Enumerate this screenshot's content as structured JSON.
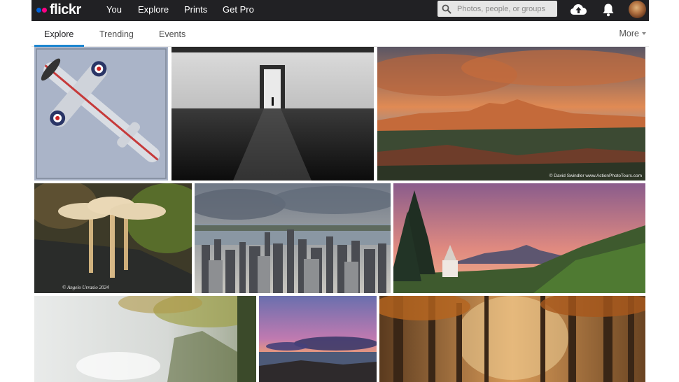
{
  "header": {
    "logo_text": "flickr",
    "nav": [
      {
        "label": "You"
      },
      {
        "label": "Explore"
      },
      {
        "label": "Prints"
      },
      {
        "label": "Get Pro"
      }
    ],
    "search": {
      "placeholder": "Photos, people, or groups",
      "value": ""
    },
    "icons": [
      "upload-cloud-icon",
      "notification-bell-icon",
      "user-avatar"
    ]
  },
  "subnav": {
    "tabs": [
      {
        "label": "Explore",
        "active": true
      },
      {
        "label": "Trending",
        "active": false
      },
      {
        "label": "Events",
        "active": false
      }
    ],
    "more_label": "More"
  },
  "photos": [
    {
      "subject": "spitfire aircraft",
      "credit": ""
    },
    {
      "subject": "black and white corridor",
      "credit": ""
    },
    {
      "subject": "canyon sunset",
      "credit": "© David Swindler  www.ActionPhotoTours.com"
    },
    {
      "subject": "mushrooms on stump",
      "credit": "© Angelo Urrasio 2024"
    },
    {
      "subject": "city skyline",
      "credit": ""
    },
    {
      "subject": "alpine church at dusk",
      "credit": ""
    },
    {
      "subject": "misty forest waterfall",
      "credit": ""
    },
    {
      "subject": "coast at sunset",
      "credit": ""
    },
    {
      "subject": "autumn forest",
      "credit": ""
    }
  ],
  "colors": {
    "topbar": "#212124",
    "accent_blue": "#0063dc",
    "accent_pink": "#ff0084",
    "tab_underline": "#1d86d0"
  }
}
